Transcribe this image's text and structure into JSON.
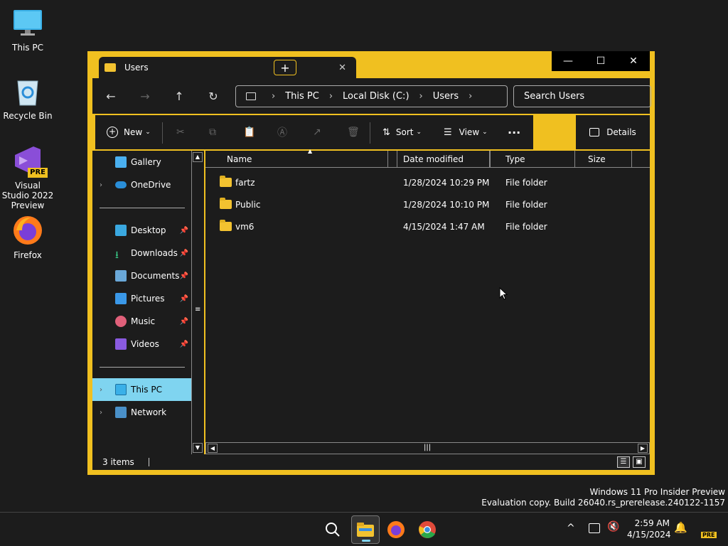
{
  "desktop": {
    "icons": [
      {
        "label": "This PC",
        "icon": "monitor-icon"
      },
      {
        "label": "Recycle Bin",
        "icon": "recycle-bin-icon"
      },
      {
        "label": "Visual Studio 2022 Preview",
        "icon": "visual-studio-icon",
        "badge": "PRE"
      },
      {
        "label": "Firefox",
        "icon": "firefox-icon"
      }
    ]
  },
  "window": {
    "tab_title": "Users",
    "new_tab_label": "+",
    "controls": {
      "minimize": "—",
      "maximize": "☐",
      "close": "✕"
    }
  },
  "address": {
    "crumbs": [
      "This PC",
      "Local Disk (C:)",
      "Users"
    ],
    "search_placeholder": "Search Users"
  },
  "toolbar": {
    "new_label": "New",
    "sort_label": "Sort",
    "view_label": "View",
    "more_label": "···",
    "details_label": "Details"
  },
  "nav_pane": {
    "top_items": [
      {
        "label": "Gallery",
        "icon": "gallery-icon"
      },
      {
        "label": "OneDrive",
        "icon": "onedrive-icon"
      }
    ],
    "quick_access": [
      {
        "label": "Desktop",
        "icon": "desktop-icon"
      },
      {
        "label": "Downloads",
        "icon": "downloads-icon"
      },
      {
        "label": "Documents",
        "icon": "documents-icon"
      },
      {
        "label": "Pictures",
        "icon": "pictures-icon"
      },
      {
        "label": "Music",
        "icon": "music-icon"
      },
      {
        "label": "Videos",
        "icon": "videos-icon"
      }
    ],
    "bottom_items": [
      {
        "label": "This PC",
        "icon": "this-pc-icon",
        "selected": true
      },
      {
        "label": "Network",
        "icon": "network-icon"
      }
    ]
  },
  "columns": [
    "Name",
    "Date modified",
    "Type",
    "Size"
  ],
  "files": [
    {
      "name": "fartz",
      "date": "1/28/2024 10:29 PM",
      "type": "File folder",
      "size": ""
    },
    {
      "name": "Public",
      "date": "1/28/2024 10:10 PM",
      "type": "File folder",
      "size": ""
    },
    {
      "name": "vm6",
      "date": "4/15/2024 1:47 AM",
      "type": "File folder",
      "size": ""
    }
  ],
  "status": {
    "item_count": "3 items"
  },
  "watermark": {
    "line1": "Windows 11 Pro Insider Preview",
    "line2": "Evaluation copy. Build 26040.rs_prerelease.240122-1157"
  },
  "taskbar": {
    "time": "2:59 AM",
    "date": "4/15/2024",
    "badge": "PRE",
    "overflow_glyph": "^"
  },
  "colors": {
    "accent": "#f0c020",
    "surface": "#1c1c1c",
    "selected": "#7fd4f0"
  }
}
